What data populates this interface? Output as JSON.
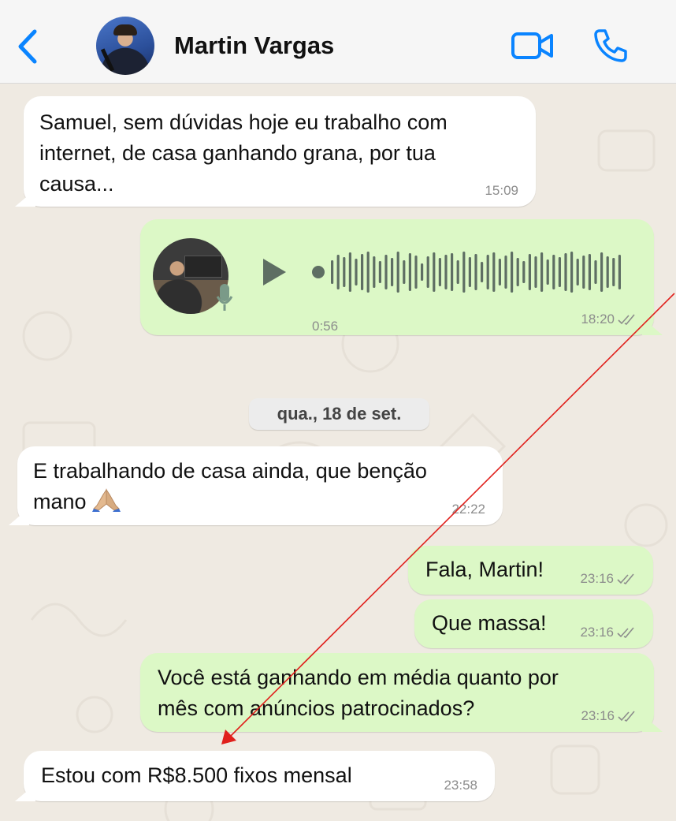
{
  "header": {
    "contact_name": "Martin Vargas",
    "back_icon": "chevron-left-icon",
    "video_icon": "video-camera-icon",
    "phone_icon": "phone-icon",
    "accent": "#0a84ff"
  },
  "messages": [
    {
      "direction": "incoming",
      "text": "Samuel, sem dúvidas hoje eu trabalho com\ninternet, de casa ganhando grana, por tua\ncausa...",
      "time": "15:09"
    },
    {
      "direction": "outgoing",
      "type": "voice",
      "duration": "0:56",
      "time": "18:20",
      "read": true
    },
    {
      "direction": "incoming",
      "text": "E trabalhando de casa ainda, que benção\nmano",
      "emoji": "folded-hands",
      "time": "22:22"
    },
    {
      "direction": "outgoing",
      "text": "Fala, Martin!",
      "time": "23:16",
      "read": true
    },
    {
      "direction": "outgoing",
      "text": "Que massa!",
      "time": "23:16",
      "read": true
    },
    {
      "direction": "outgoing",
      "text": "Você está ganhando em média quanto por\nmês com anúncios patrocinados?",
      "time": "23:16",
      "read": true
    },
    {
      "direction": "incoming",
      "text": "Estou com R$8.500 fixos mensal",
      "time": "23:58"
    }
  ],
  "date_separator": "qua., 18 de set.",
  "colors": {
    "wallpaper": "#efeae2",
    "incoming_bubble": "#ffffff",
    "outgoing_bubble": "#dcf8c6",
    "annotation_arrow": "#e0201c"
  }
}
